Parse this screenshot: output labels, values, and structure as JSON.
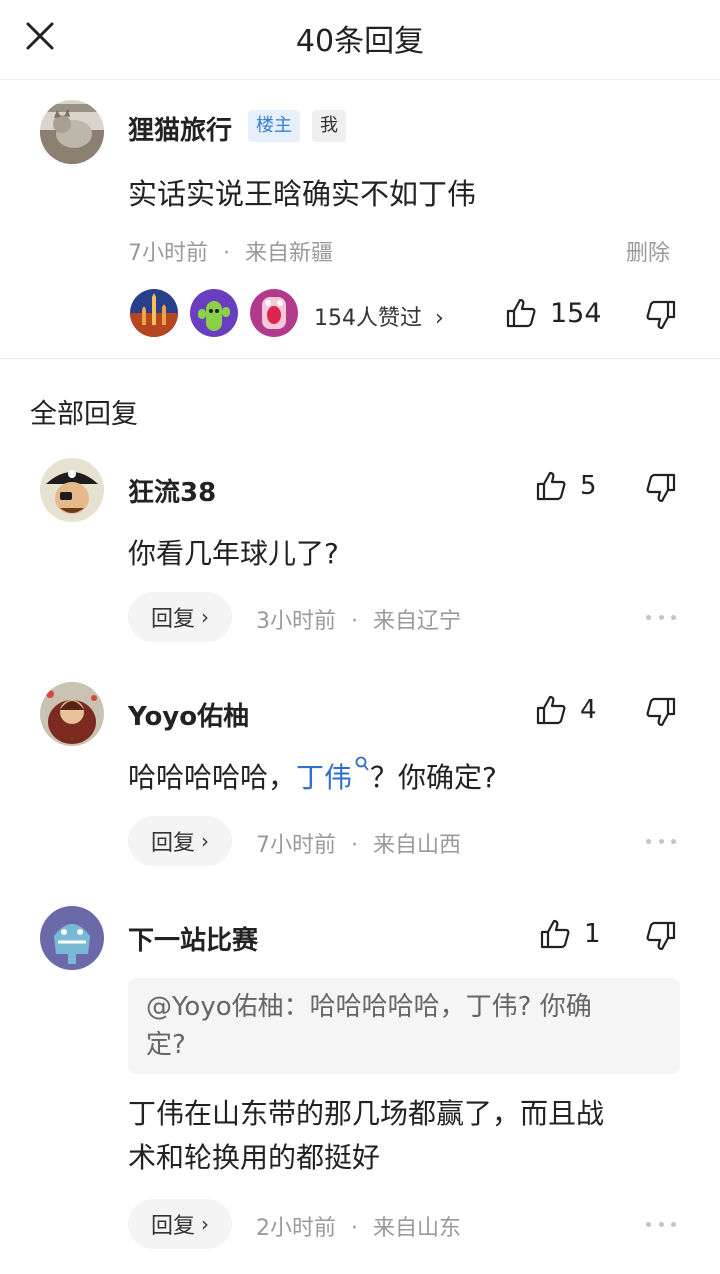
{
  "header": {
    "title": "40条回复",
    "close_icon": "close-icon"
  },
  "main_comment": {
    "author": "狸猫旅行",
    "badge_owner": "楼主",
    "badge_me": "我",
    "text": "实话实说王晗确实不如丁伟",
    "time": "7小时前",
    "location": "来自新疆",
    "delete_label": "删除",
    "likers_label": "154人赞过",
    "like_count": "154"
  },
  "section_title": "全部回复",
  "replies": [
    {
      "author": "狂流38",
      "like_count": "5",
      "text": "你看几年球儿了?",
      "reply_label": "回复",
      "time": "3小时前",
      "location": "来自辽宁"
    },
    {
      "author": "Yoyo佑柚",
      "like_count": "4",
      "text_prefix": "哈哈哈哈哈，",
      "text_link": "丁伟",
      "text_suffix": "？你确定?",
      "reply_label": "回复",
      "time": "7小时前",
      "location": "来自山西"
    },
    {
      "author": "下一站比赛",
      "like_count": "1",
      "quote_line1": "@Yoyo佑柚：哈哈哈哈哈，丁伟? 你确",
      "quote_line2": "定?",
      "text_line1": "丁伟在山东带的那几场都赢了，而且战",
      "text_line2": "术和轮换用的都挺好",
      "reply_label": "回复",
      "time": "2小时前",
      "location": "来自山东"
    }
  ],
  "separator": "·",
  "colors": {
    "link": "#2f6fc5",
    "meta_gray": "#9a9a9a",
    "badge_owner_bg": "#e6f0fb",
    "badge_owner_text": "#3a7bd5"
  }
}
